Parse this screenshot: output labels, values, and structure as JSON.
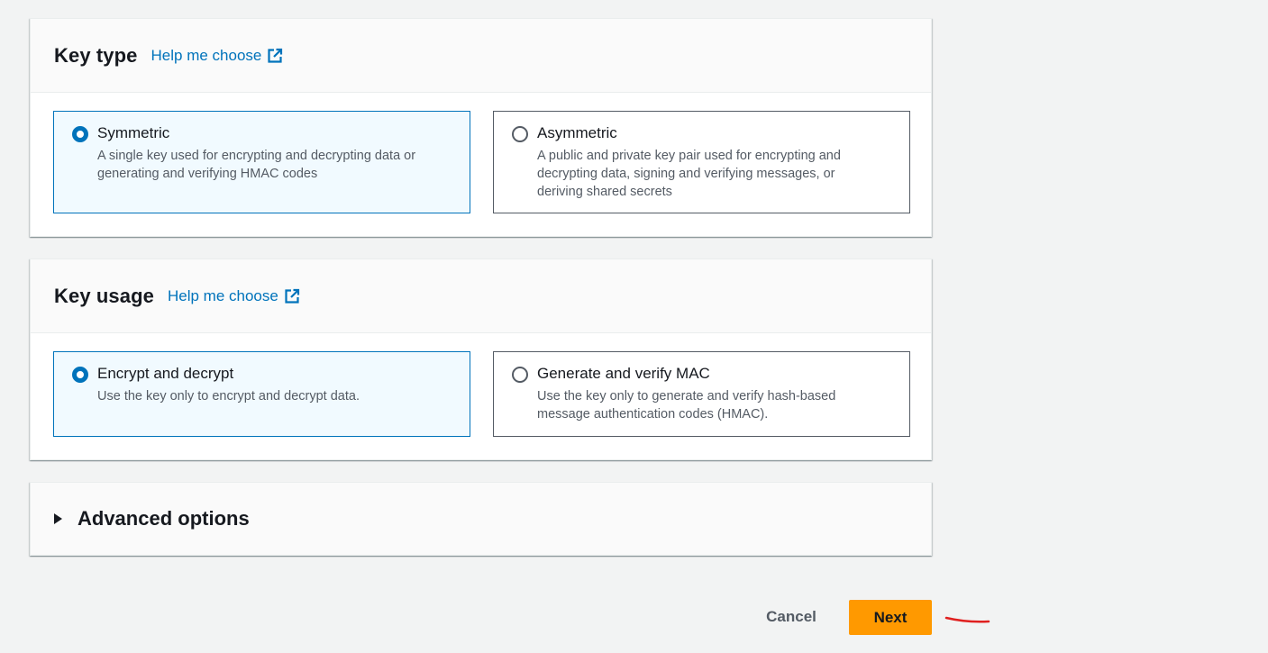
{
  "colors": {
    "accent": "#0073bb",
    "selected_tile_bg": "#f1faff",
    "primary_button": "#ff9900",
    "annotation": "#e0201f"
  },
  "key_type": {
    "title": "Key type",
    "help_link": "Help me choose",
    "help_icon": "external-link-icon",
    "options": [
      {
        "title": "Symmetric",
        "description": "A single key used for encrypting and decrypting data or generating and verifying HMAC codes",
        "selected": true
      },
      {
        "title": "Asymmetric",
        "description": "A public and private key pair used for encrypting and decrypting data, signing and verifying messages, or deriving shared secrets",
        "selected": false
      }
    ]
  },
  "key_usage": {
    "title": "Key usage",
    "help_link": "Help me choose",
    "help_icon": "external-link-icon",
    "options": [
      {
        "title": "Encrypt and decrypt",
        "description": "Use the key only to encrypt and decrypt data.",
        "selected": true
      },
      {
        "title": "Generate and verify MAC",
        "description": "Use the key only to generate and verify hash-based message authentication codes (HMAC).",
        "selected": false
      }
    ]
  },
  "advanced": {
    "title": "Advanced options",
    "icon": "caret-right-icon",
    "expanded": false
  },
  "actions": {
    "cancel_label": "Cancel",
    "next_label": "Next"
  }
}
